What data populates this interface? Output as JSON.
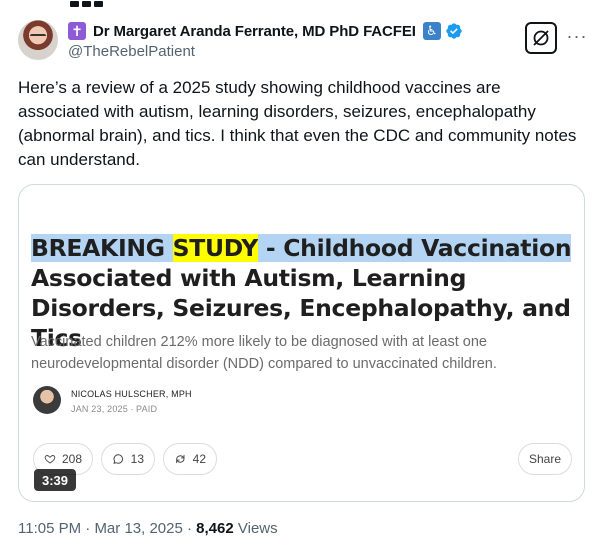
{
  "author": {
    "display_name": "Dr Margaret Aranda Ferrante, MD PhD FACFEI",
    "handle": "@TheRebelPatient",
    "badge_icons": [
      "cross-icon",
      "accessibility-icon",
      "verified-icon"
    ],
    "verified_color": "#1d9bf0"
  },
  "tweet": {
    "text": "Here’s a review of a 2025 study showing childhood vaccines are associated with autism, learning disorders, seizures, encephalopathy (abnormal brain), and tics. I think that even the CDC and community notes can understand."
  },
  "card": {
    "title_part1": "BREAKING ",
    "title_part2": "STUDY",
    "title_part3": " - Childhood Vaccination",
    "title_part4": "Associated with Autism, Learning Disorders, Seizures, Encephalopathy, and Tics",
    "subtitle": "Vaccinated children 212% more likely to be diagnosed with at least one neurodevelopmental disorder (NDD) compared to unvaccinated children.",
    "author_name": "NICOLAS HULSCHER, MPH",
    "date": "JAN 23, 2025 ∙ PAID",
    "likes": "208",
    "comments": "13",
    "restacks": "42",
    "share_label": "Share",
    "video_duration": "3:39",
    "highlight_colors": {
      "blue": "#b3d4f3",
      "yellow": "#ffff00"
    }
  },
  "meta": {
    "time": "11:05 PM",
    "separator": " · ",
    "date": "Mar 13, 2025",
    "views_count": "8,462",
    "views_label": " Views"
  }
}
